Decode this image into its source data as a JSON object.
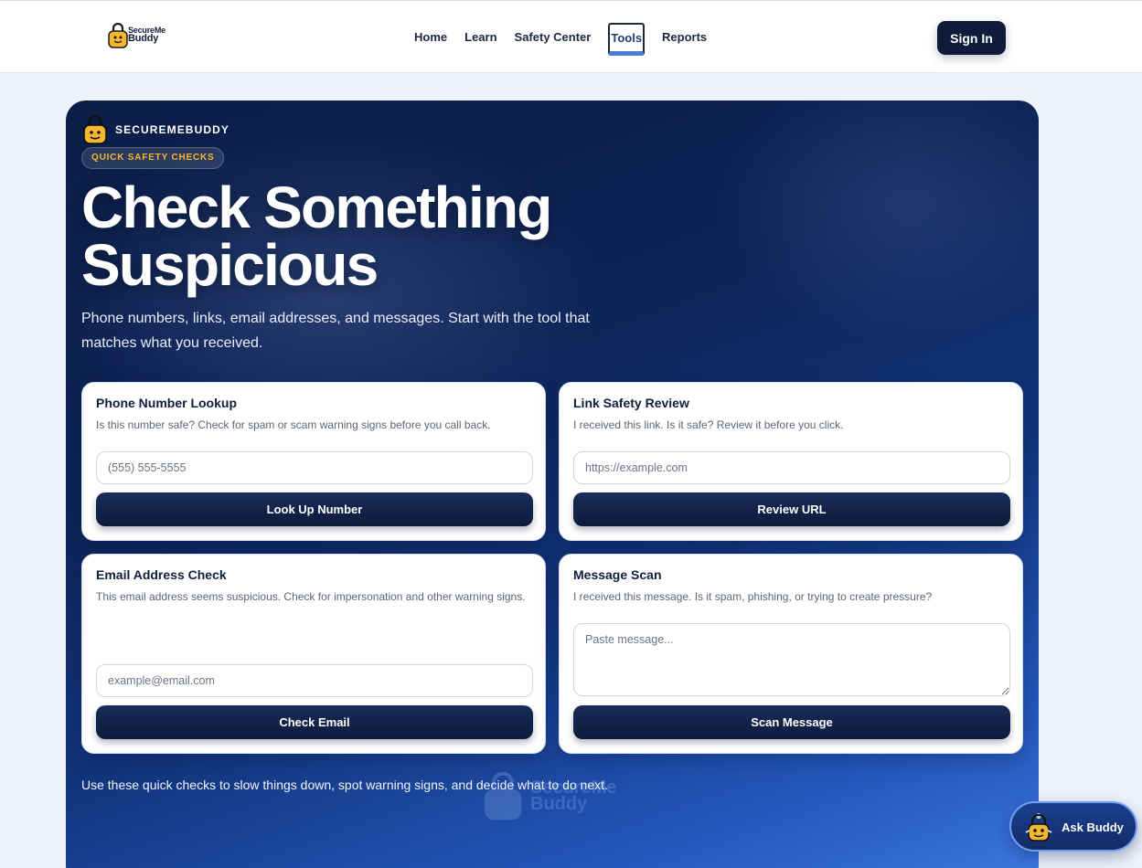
{
  "nav": {
    "logo_line1": "SecureMe",
    "logo_line2": "Buddy",
    "links": [
      "Home",
      "Learn",
      "Safety Center",
      "Tools",
      "Reports"
    ],
    "active_link": "Tools",
    "signin_label": "Sign In"
  },
  "hero": {
    "brand": "SECUREMEBUDDY",
    "pill": "QUICK SAFETY CHECKS",
    "title_line1": "Check Something",
    "title_line2": "Suspicious",
    "subtitle": "Phone numbers, links, email addresses, and messages. Start with the tool that matches what you received.",
    "footer": "Use these quick checks to slow things down, spot warning signs, and decide what to do next.",
    "watermark_line1": "SecureMe",
    "watermark_line2": "Buddy"
  },
  "cards": {
    "phone": {
      "title": "Phone Number Lookup",
      "desc": "Is this number safe? Check for spam or scam warning signs before you call back.",
      "placeholder": "(555) 555-5555",
      "button": "Look Up Number"
    },
    "link": {
      "title": "Link Safety Review",
      "desc": "I received this link. Is it safe? Review it before you click.",
      "placeholder": "https://example.com",
      "button": "Review URL"
    },
    "email": {
      "title": "Email Address Check",
      "desc": "This email address seems suspicious. Check for impersonation and other warning signs.",
      "placeholder": "example@email.com",
      "button": "Check Email"
    },
    "message": {
      "title": "Message Scan",
      "desc": "I received this message. Is it spam, phishing, or trying to create pressure?",
      "placeholder": "Paste message...",
      "button": "Scan Message"
    }
  },
  "assistant": {
    "label": "Ask Buddy"
  },
  "colors": {
    "navy": "#0e1b3a",
    "accent": "#f5b731",
    "hero_start": "#0b1d47",
    "hero_end": "#3f79e0"
  }
}
